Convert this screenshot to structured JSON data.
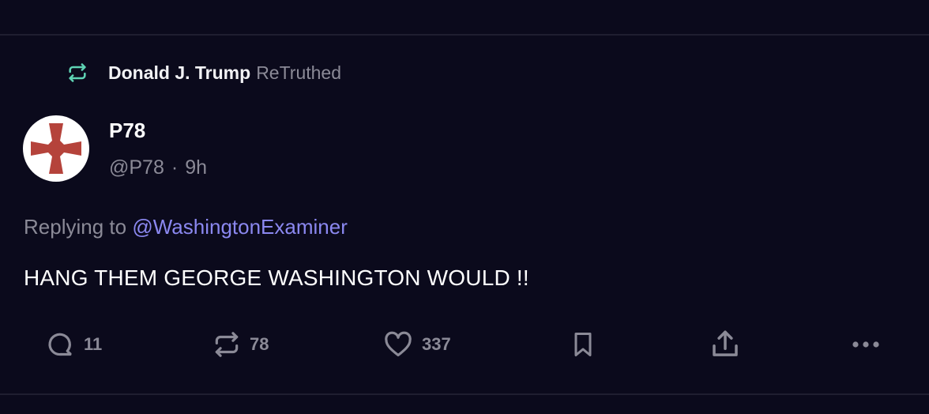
{
  "retruth": {
    "name": "Donald J. Trump",
    "verb": "ReTruthed"
  },
  "post": {
    "display_name": "P78",
    "handle": "@P78",
    "separator": "·",
    "time": "9h",
    "reply_prefix": "Replying to",
    "reply_mention": "@WashingtonExaminer",
    "text": "HANG THEM GEORGE WASHINGTON WOULD !!"
  },
  "actions": {
    "replies": "11",
    "retruths": "78",
    "likes": "337"
  },
  "colors": {
    "background": "#0b0a1c",
    "retruth_accent": "#5fd3b4",
    "mention": "#8b88f0",
    "muted": "#8b8a97",
    "avatar_cross": "#b5433b"
  },
  "icons": [
    "retruth-icon",
    "avatar-cross",
    "comment-icon",
    "retruth-icon",
    "heart-icon",
    "bookmark-icon",
    "share-icon",
    "more-icon"
  ]
}
